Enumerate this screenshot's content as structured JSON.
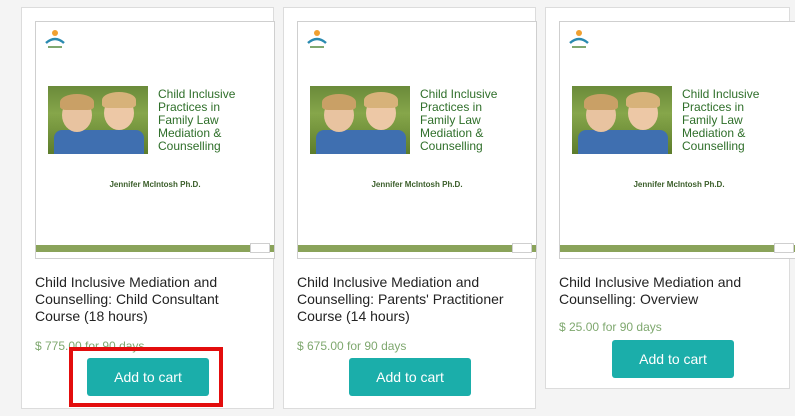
{
  "slide": {
    "title_lines": [
      "Child Inclusive",
      "Practices in",
      "Family Law",
      "Mediation &",
      "Counselling"
    ],
    "author": "Jennifer McIntosh Ph.D."
  },
  "products": [
    {
      "name": "Child Inclusive Mediation and Counselling: Child Consultant Course (18 hours)",
      "price": "$ 775.00 for 90 days",
      "button": "Add to cart"
    },
    {
      "name": "Child Inclusive Mediation and Counselling: Parents' Practitioner Course (14 hours)",
      "price": "$ 675.00 for 90 days",
      "button": "Add to cart"
    },
    {
      "name": "Child Inclusive Mediation and Counselling: Overview",
      "price": "$ 25.00 for 90 days",
      "button": "Add to cart"
    }
  ],
  "colors": {
    "button": "#1baeaa",
    "price": "#7fa86f",
    "highlight": "#e30d0d",
    "slide_title": "#2f6f2a"
  },
  "icons": {
    "logo": "org-logo-icon",
    "photo": "children-photo"
  }
}
